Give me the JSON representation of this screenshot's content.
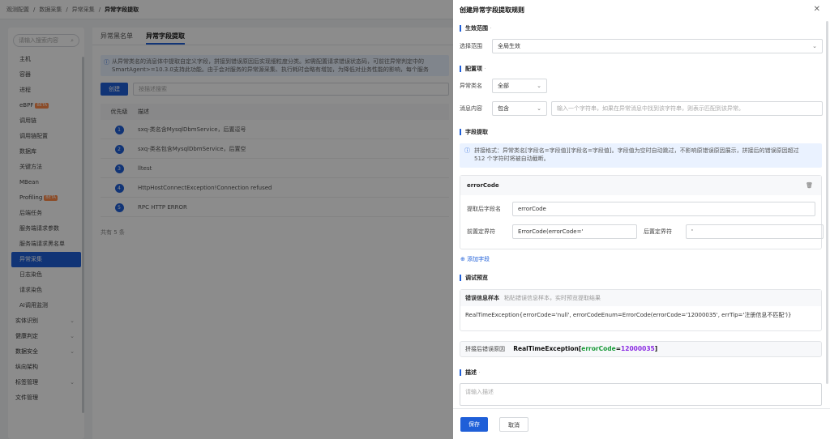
{
  "breadcrumb": [
    "观测配置",
    "数据采集",
    "异常采集",
    "异常字段提取"
  ],
  "sidebar": {
    "search_placeholder": "请输入搜索内容",
    "items": [
      {
        "label": "主机"
      },
      {
        "label": "容器"
      },
      {
        "label": "进程"
      },
      {
        "label": "eBPF",
        "badge": "BETA"
      },
      {
        "label": "调用链"
      },
      {
        "label": "调用链配置"
      },
      {
        "label": "数据库"
      },
      {
        "label": "关键方法"
      },
      {
        "label": "MBean"
      },
      {
        "label": "Profiling",
        "badge": "BETA"
      },
      {
        "label": "后端任务"
      },
      {
        "label": "服务端请求参数"
      },
      {
        "label": "服务端请求黑名单"
      },
      {
        "label": "异常采集",
        "active": true
      },
      {
        "label": "日志染色"
      },
      {
        "label": "请求染色"
      },
      {
        "label": "AI调用监测"
      }
    ],
    "groups": [
      {
        "label": "实体识别"
      },
      {
        "label": "健康判定"
      },
      {
        "label": "数据安全"
      },
      {
        "label": "纵向架构"
      },
      {
        "label": "标签管理"
      },
      {
        "label": "文件管理"
      }
    ]
  },
  "main": {
    "tabs": [
      {
        "label": "异常黑名单",
        "active": false
      },
      {
        "label": "异常字段提取",
        "active": true
      }
    ],
    "notice_line1": "从异常类名的消息体中提取自定义字段，拼接到错误原因后实现细粒度分类。如需配置请求错误状态码，可前往异常判定中的",
    "notice_line2": "SmartAgent>=10.3.0支持此功能。由于会对服务的异常源采集、执行耗时会略有增加，为降低对业务性能的影响，每个服务",
    "create_label": "创建",
    "search_placeholder": "按描述搜索",
    "columns": [
      "优先级",
      "描述"
    ],
    "rows": [
      {
        "priority": "1",
        "desc": "sxq-类名含MysqlDbmService，后置逗号"
      },
      {
        "priority": "2",
        "desc": "sxq-类名包含MysqlDbmService，后置空"
      },
      {
        "priority": "3",
        "desc": "lltest"
      },
      {
        "priority": "4",
        "desc": "HttpHostConnectException!Connection refused"
      },
      {
        "priority": "5",
        "desc": "RPC HTTP ERROR"
      }
    ],
    "total": "共有 5 条"
  },
  "drawer": {
    "title": "创建异常字段提取规则",
    "close_icon": "close-icon",
    "scope": {
      "section": "生效范围",
      "section_req": "·",
      "label": "选择范围",
      "value": "全局生效"
    },
    "config": {
      "section": "配置项",
      "section_req": "·",
      "class_label": "异常类名",
      "class_value": "全部",
      "msg_label": "消息内容",
      "msg_op": "包含",
      "msg_placeholder": "输入一个字符串，如果在异常消息中找到该字符串，则表示匹配到该异常。"
    },
    "extract": {
      "section": "字段提取",
      "notice_line1": "拼接格式：异常类名[字段名=字段值][字段名=字段值]。字段值为空时自动跳过，不影响原错误原因展示，拼接后的错误原因超过",
      "notice_line2": "512 个字符时将被自动截断。",
      "card_title": "errorCode",
      "field_name_label": "提取后字段名",
      "field_name_value": "errorCode",
      "prefix_label": "前置定界符",
      "prefix_value": "ErrorCode(errorCode='",
      "suffix_label": "后置定界符",
      "suffix_value": "'",
      "add_label": "添加字段"
    },
    "preview": {
      "section": "调试预览",
      "sample_label": "错误信息样本",
      "sample_placeholder": "粘贴错误信息样本，实时预览提取结果",
      "sample_value": "RealTimeException{errorCode='null', errorCodeEnum=ErrorCode(errorCode='12000035', errTip='注册信息不匹配')}",
      "result_label": "拼接后错误原因",
      "result_class": "RealTimeException",
      "result_key": "errorCode",
      "result_val": "12000035"
    },
    "desc": {
      "section": "描述",
      "section_req": "·",
      "placeholder": "请输入描述"
    },
    "save_label": "保存",
    "cancel_label": "取消"
  }
}
